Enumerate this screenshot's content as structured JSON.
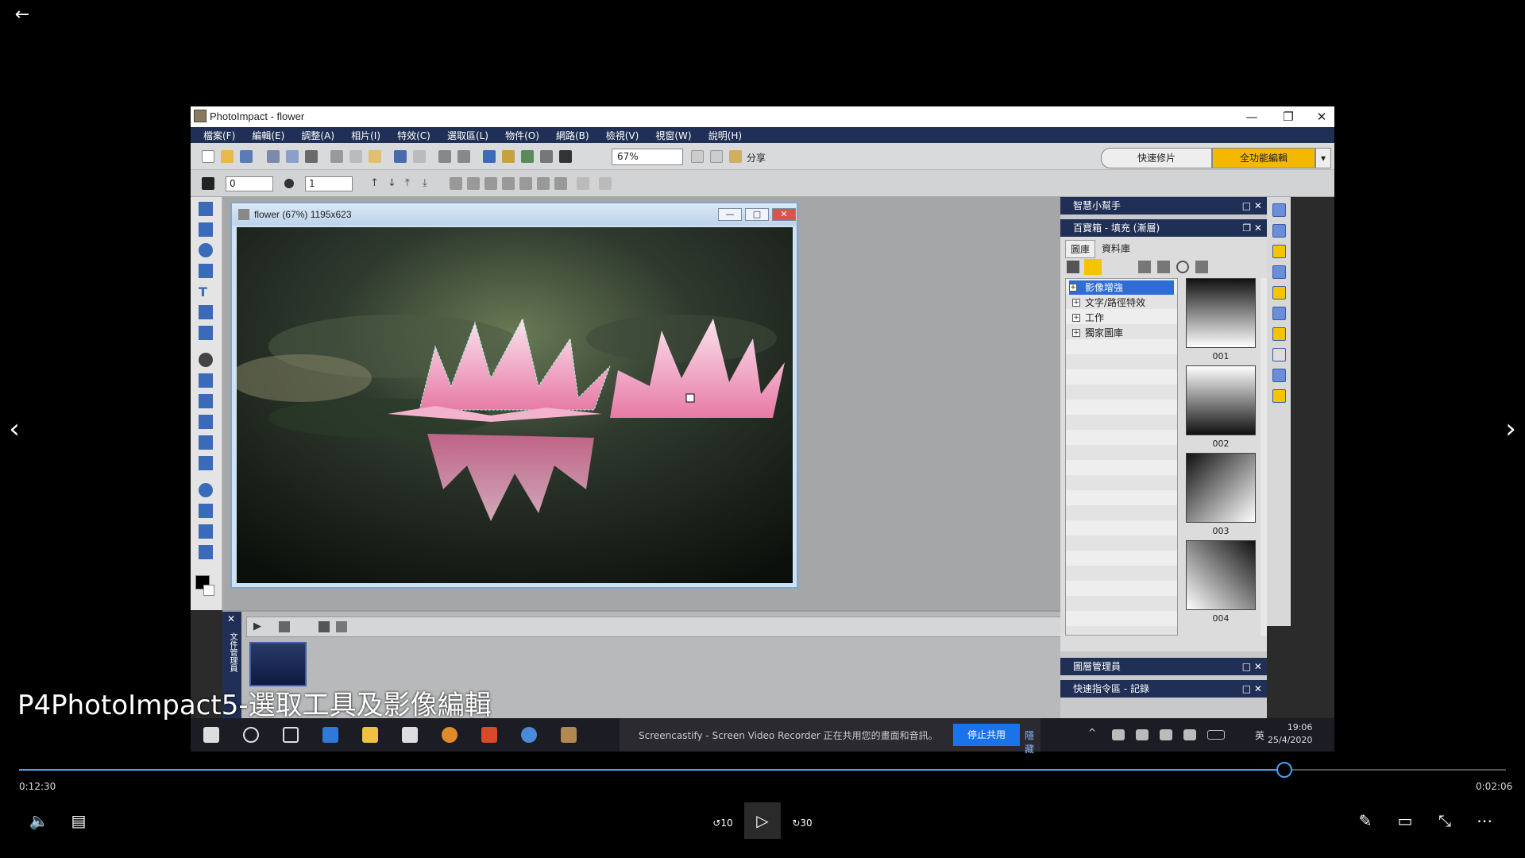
{
  "player": {
    "back_icon": "arrow-left-icon",
    "prev_icon": "chevron-left-icon",
    "next_icon": "chevron-right-icon",
    "caption": "P4PhotoImpact5-選取工具及影像編輯",
    "time_current": "0:12:30",
    "time_total": "0:02:06",
    "progress_fraction": 0.851,
    "accent": "#4aa3f0",
    "rewind_label": "10",
    "forward_label": "30"
  },
  "photoimpact": {
    "window_title": "PhotoImpact - flower",
    "menu": [
      "檔案(F)",
      "編輯(E)",
      "調整(A)",
      "相片(I)",
      "特效(C)",
      "選取區(L)",
      "物件(O)",
      "網路(B)",
      "檢視(V)",
      "視窗(W)",
      "說明(H)"
    ],
    "zoom": "67%",
    "share_label": "分享",
    "mode_quick": "快速修片",
    "mode_full": "全功能編輯",
    "spin1": "0",
    "spin2": "1",
    "doc_title": "flower (67%) 1195x623",
    "right_panel": {
      "smart_helper": "智慧小幫手",
      "easy_palette": "百寶箱 - 填充 (漸層)",
      "tabs": [
        "圖庫",
        "資料庫"
      ],
      "tree": [
        "影像增強",
        "文字/路徑特效",
        "工作",
        "獨家圖庫"
      ],
      "swatches": [
        "001",
        "002",
        "003",
        "004"
      ],
      "layer_manager": "圖層管理員",
      "quick_cmd": "快速指令區 - 記錄"
    },
    "doc_manager_label": "文件管理員"
  },
  "taskbar": {
    "screencast_msg": "Screencastify - Screen Video Recorder 正在共用您的畫面和音訊。",
    "stop_share": "停止共用",
    "hide": "隱藏",
    "ime": "英",
    "time": "19:06",
    "date": "25/4/2020"
  }
}
